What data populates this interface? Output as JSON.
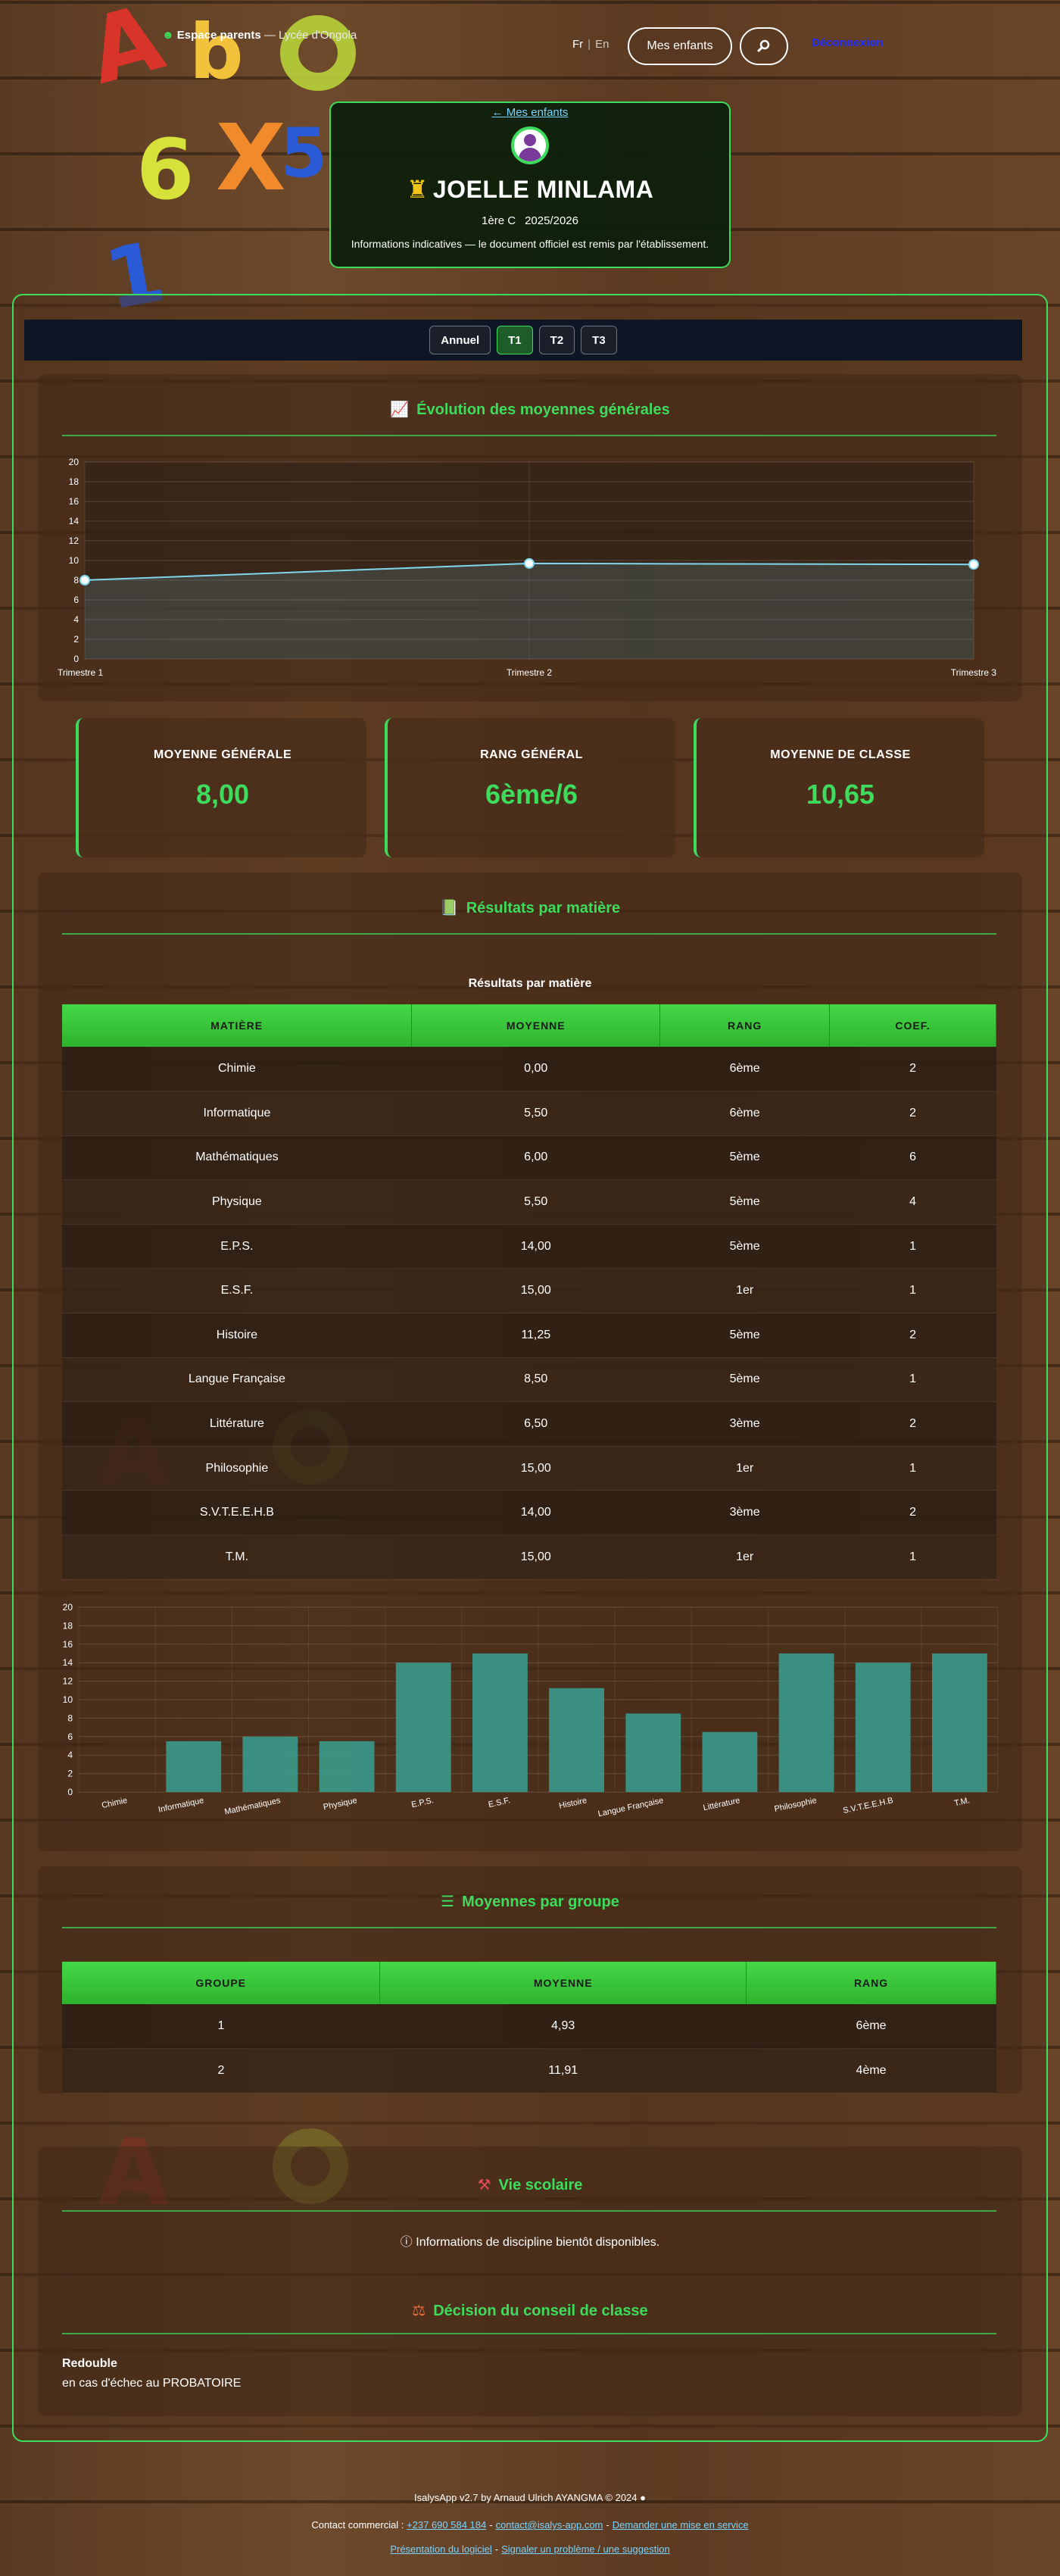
{
  "header": {
    "brand_title": "Espace parents",
    "brand_separator": "—",
    "school": "Lycée d'Ongola",
    "lang_fr": "Fr",
    "lang_en": "En",
    "children_button": "Mes enfants",
    "logout": "Déconnexion"
  },
  "profile": {
    "back_link": "Mes enfants",
    "name": "JOELLE MINLAMA",
    "class": "1ère C",
    "year": "2025/2026",
    "note": "Informations indicatives — le document officiel est remis par l'établissement."
  },
  "tabs": [
    {
      "label": "Annuel",
      "active": false
    },
    {
      "label": "T1",
      "active": true
    },
    {
      "label": "T2",
      "active": false
    },
    {
      "label": "T3",
      "active": false
    }
  ],
  "evolution": {
    "title": "Évolution des moyennes générales"
  },
  "stats": {
    "general_avg_label": "MOYENNE GÉNÉRALE",
    "general_avg_value": "8,00",
    "rank_label": "RANG GÉNÉRAL",
    "rank_value": "6ème/6",
    "class_avg_label": "MOYENNE DE CLASSE",
    "class_avg_value": "10,65"
  },
  "results": {
    "title": "Résultats par matière",
    "caption": "Résultats par matière",
    "headers": [
      "MATIÈRE",
      "MOYENNE",
      "RANG",
      "COEF."
    ],
    "rows": [
      [
        "Chimie",
        "0,00",
        "6ème",
        "2"
      ],
      [
        "Informatique",
        "5,50",
        "6ème",
        "2"
      ],
      [
        "Mathématiques",
        "6,00",
        "5ème",
        "6"
      ],
      [
        "Physique",
        "5,50",
        "5ème",
        "4"
      ],
      [
        "E.P.S.",
        "14,00",
        "5ème",
        "1"
      ],
      [
        "E.S.F.",
        "15,00",
        "1er",
        "1"
      ],
      [
        "Histoire",
        "11,25",
        "5ème",
        "2"
      ],
      [
        "Langue Française",
        "8,50",
        "5ème",
        "1"
      ],
      [
        "Littérature",
        "6,50",
        "3ème",
        "2"
      ],
      [
        "Philosophie",
        "15,00",
        "1er",
        "1"
      ],
      [
        "S.V.T.E.E.H.B",
        "14,00",
        "3ème",
        "2"
      ],
      [
        "T.M.",
        "15,00",
        "1er",
        "1"
      ]
    ]
  },
  "groups": {
    "title": "Moyennes par groupe",
    "headers": [
      "GROUPE",
      "MOYENNE",
      "RANG"
    ],
    "rows": [
      [
        "1",
        "4,93",
        "6ème"
      ],
      [
        "2",
        "11,91",
        "4ème"
      ]
    ]
  },
  "school_life": {
    "title": "Vie scolaire",
    "discipline_text": "Informations de discipline bientôt disponibles."
  },
  "decision": {
    "title": "Décision du conseil de classe",
    "label": "Redouble",
    "text": "en cas d'échec au PROBATOIRE"
  },
  "footer": {
    "credit": "IsalysApp v2.7 by Arnaud Ulrich AYANGMA © 2024",
    "contact_label": "Contact commercial :",
    "phone": "+237 690 584 184",
    "email": "contact@isalys-app.com",
    "service_link": "Demander une mise en service",
    "presentation_link": "Présentation du logiciel",
    "report_link": "Signaler un problème / une suggestion",
    "dash": "-"
  },
  "colors": {
    "accent": "#3ddc5c",
    "line": "#7fd8ee",
    "bar": "#3a9a8c"
  },
  "chart_data": [
    {
      "type": "line",
      "x": [
        "Trimestre 1",
        "Trimestre 2",
        "Trimestre 3"
      ],
      "values": [
        8.0,
        9.7,
        9.6
      ],
      "ylim": [
        0,
        20
      ],
      "yticks": [
        0,
        2,
        4,
        6,
        8,
        10,
        12,
        14,
        16,
        18,
        20
      ],
      "grid": true,
      "title": "",
      "xlabel": "",
      "ylabel": ""
    },
    {
      "type": "bar",
      "categories": [
        "Chimie",
        "Informatique",
        "Mathématiques",
        "Physique",
        "E.P.S.",
        "E.S.F.",
        "Histoire",
        "Langue Française",
        "Littérature",
        "Philosophie",
        "S.V.T.E.E.H.B",
        "T.M."
      ],
      "values": [
        0,
        5.5,
        6,
        5.5,
        14,
        15,
        11.25,
        8.5,
        6.5,
        15,
        14,
        15
      ],
      "ylim": [
        0,
        20
      ],
      "yticks": [
        0,
        2,
        4,
        6,
        8,
        10,
        12,
        14,
        16,
        18,
        20
      ],
      "grid": true,
      "title": "",
      "xlabel": "",
      "ylabel": ""
    }
  ]
}
